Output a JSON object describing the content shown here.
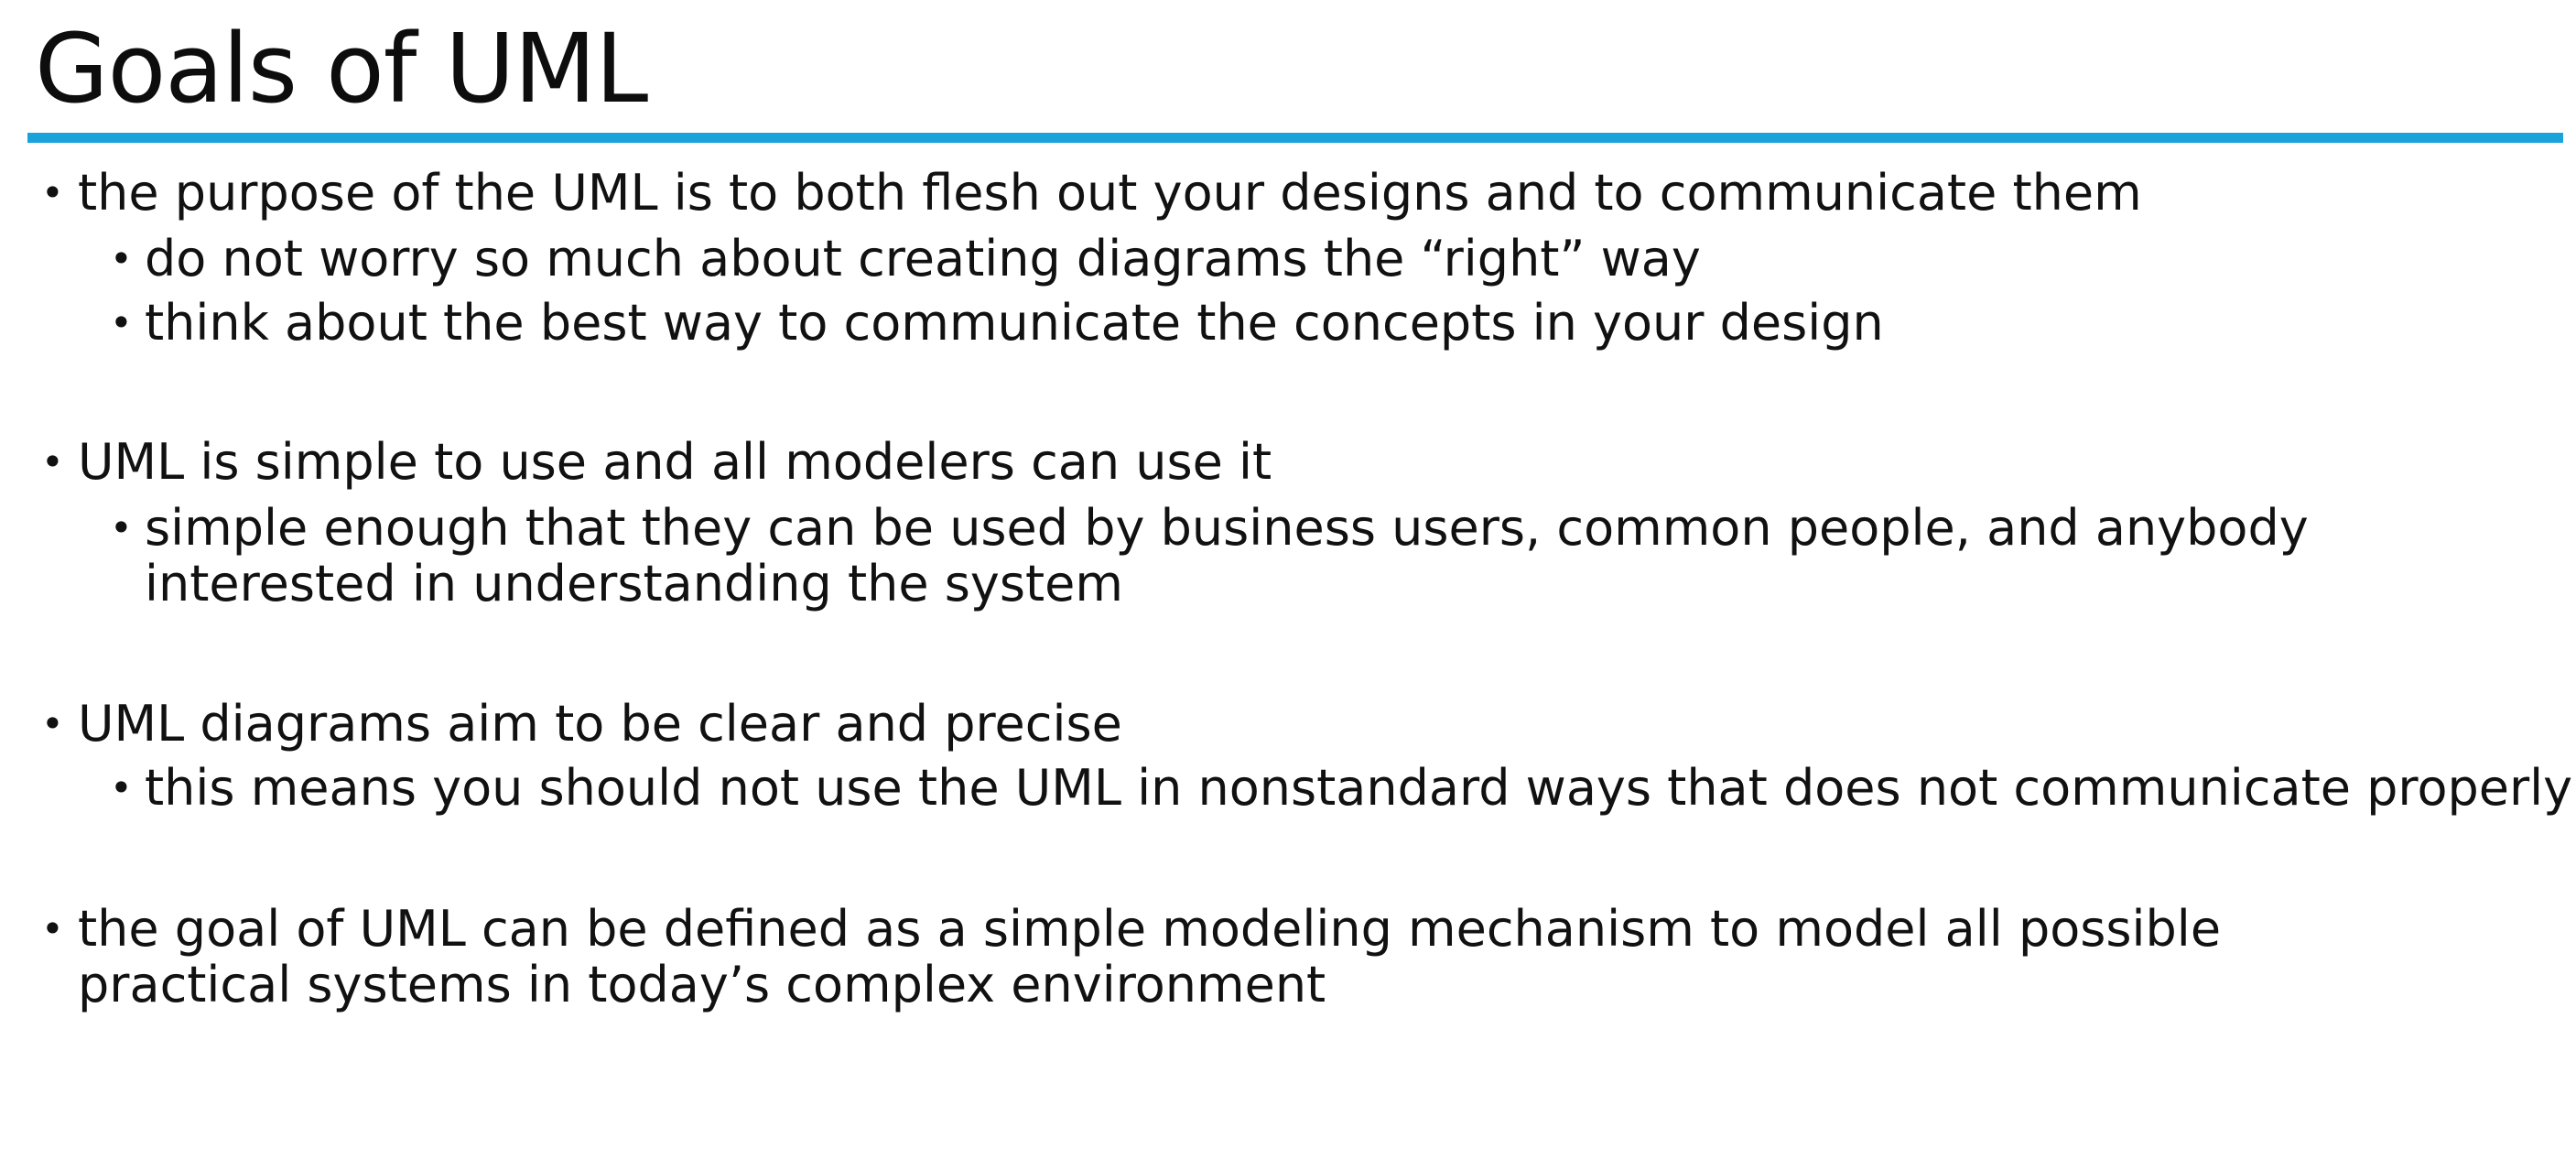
{
  "slide": {
    "title": "Goals of UML",
    "accent_color": "#1aa3db",
    "bullets": [
      {
        "text": "the purpose of the UML is to both flesh out your designs and to communicate them",
        "sub": [
          "do not worry so much about creating diagrams the “right” way",
          "think about the best way to communicate the concepts in your design"
        ]
      },
      {
        "text": "UML is simple to use and all modelers can use it",
        "sub": [
          "simple enough that they can be used by business users, common people, and anybody interested in understanding the system"
        ]
      },
      {
        "text": "UML diagrams aim to be clear and precise",
        "sub": [
          "this means you should not use the UML in nonstandard ways that does not communicate properly"
        ]
      },
      {
        "text": "the goal of UML can be defined as a simple modeling mechanism to model all possible practical systems in today’s complex environment",
        "sub": []
      }
    ]
  }
}
